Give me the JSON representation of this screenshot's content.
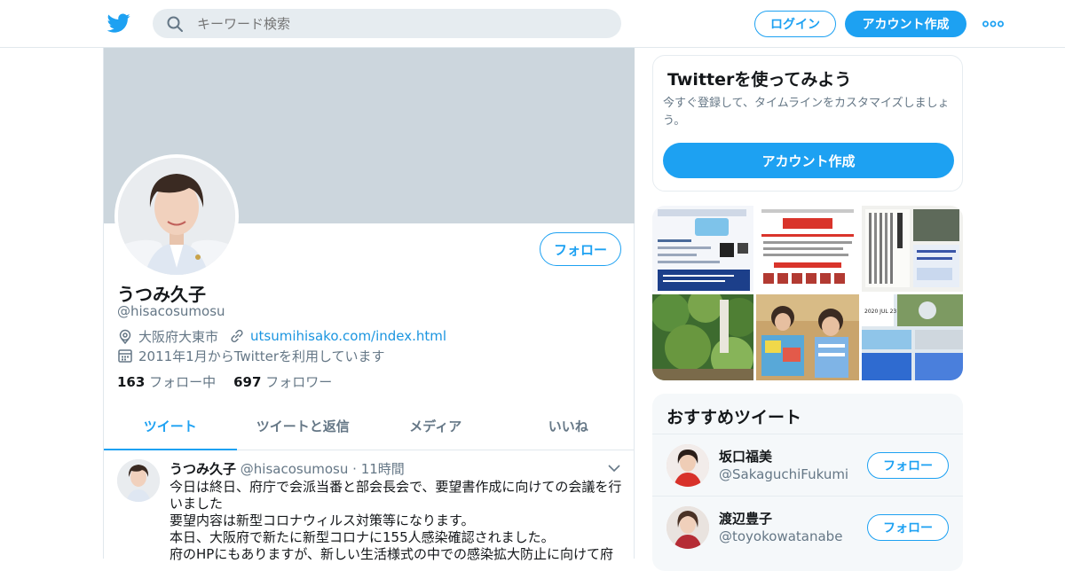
{
  "header": {
    "search_placeholder": "キーワード検索",
    "login_label": "ログイン",
    "signup_label": "アカウント作成",
    "brand_color": "#1da1f2"
  },
  "profile": {
    "name": "うつみ久子",
    "handle": "@hisacosumosu",
    "follow_label": "フォロー",
    "location": "大阪府大東市",
    "url": "utsumihisako.com/index.html",
    "joined": "2011年1月からTwitterを利用しています",
    "following_count": "163",
    "following_label": "フォロー中",
    "followers_count": "697",
    "followers_label": "フォロワー"
  },
  "tabs": [
    {
      "label": "ツイート",
      "active": true
    },
    {
      "label": "ツイートと返信",
      "active": false
    },
    {
      "label": "メディア",
      "active": false
    },
    {
      "label": "いいね",
      "active": false
    }
  ],
  "tweet": {
    "name": "うつみ久子",
    "handle": "@hisacosumosu",
    "separator": "·",
    "time": "11時間",
    "body": "今日は終日、府庁で会派当番と部会長会で、要望書作成に向けての会議を行いました\n要望内容は新型コロナウィルス対策等になります。\n本日、大阪府で新たに新型コロナに155人感染確認されました。\n府のHPにもありますが、新しい生活様式の中での感染拡大防止に向けて府"
  },
  "sidebar": {
    "try_title": "Twitterを使ってみよう",
    "try_text": "今すぐ登録して、タイムラインをカスタマイズしましょう。",
    "try_button": "アカウント作成",
    "media_date_text": "2020 JUL 23",
    "recommend_title": "おすすめツイート",
    "recommendations": [
      {
        "name": "坂口福美",
        "handle": "@SakaguchiFukumi",
        "follow_label": "フォロー"
      },
      {
        "name": "渡辺豊子",
        "handle": "@toyokowatanabe",
        "follow_label": "フォロー"
      }
    ]
  },
  "icons": {
    "logo": "twitter-bird-icon",
    "search": "search-icon",
    "more": "more-dots-icon",
    "location": "location-pin-icon",
    "link": "link-icon",
    "calendar": "calendar-icon",
    "caret": "chevron-down-icon"
  }
}
